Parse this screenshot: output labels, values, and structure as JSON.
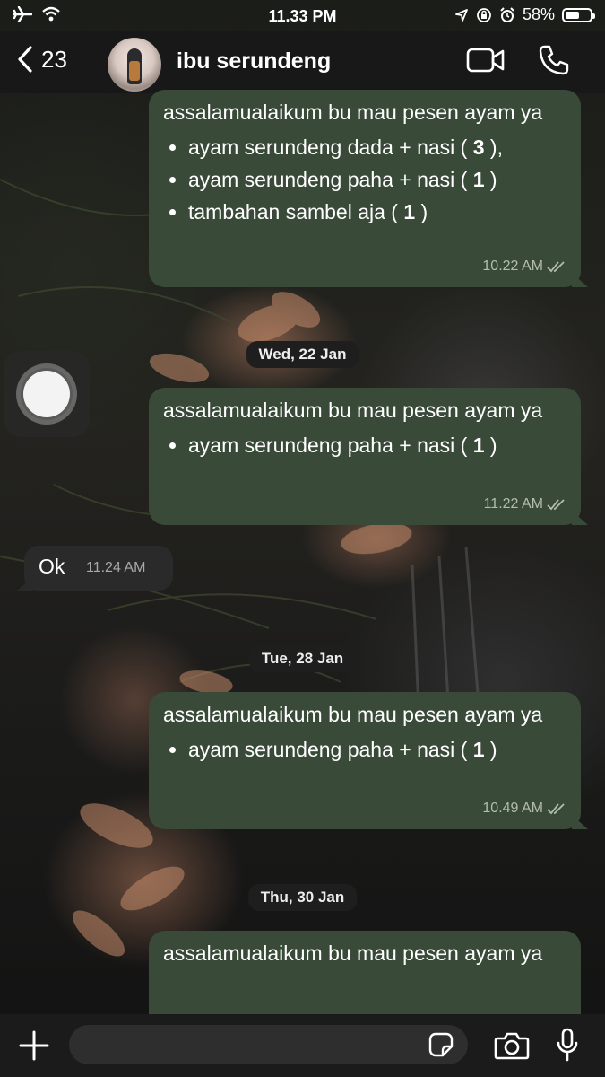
{
  "status_bar": {
    "time": "11.33 PM",
    "battery_percent": "58%",
    "battery_level": 0.58,
    "icons": [
      "airplane-icon",
      "wifi-icon",
      "location-icon",
      "orientation-lock-icon",
      "alarm-icon",
      "battery-icon"
    ]
  },
  "header": {
    "back_count": "23",
    "contact_name": "ibu serundeng",
    "icons": [
      "back-chevron-icon",
      "video-call-icon",
      "phone-call-icon"
    ]
  },
  "messages": [
    {
      "text": "assalamualaikum bu mau pesen ayam ya",
      "items": [
        {
          "text": "ayam serundeng dada + nasi ( ",
          "qty": "3",
          "suffix": " ),"
        },
        {
          "text": "ayam serundeng paha + nasi ( ",
          "qty": "1",
          "suffix": " )"
        },
        {
          "text": "tambahan sambel aja ( ",
          "qty": "1",
          "suffix": " )"
        }
      ],
      "time": "10.22 AM"
    },
    {
      "date": "Wed, 22 Jan",
      "text": "assalamualaikum bu mau pesen ayam ya",
      "items": [
        {
          "text": "ayam serundeng paha + nasi ( ",
          "qty": "1",
          "suffix": " )"
        }
      ],
      "time": "11.22 AM"
    },
    {
      "incoming_text": "Ok",
      "time": "11.24 AM"
    },
    {
      "date": "Tue, 28 Jan",
      "text": "assalamualaikum bu mau pesen ayam ya",
      "items": [
        {
          "text": "ayam serundeng paha + nasi ( ",
          "qty": "1",
          "suffix": " )"
        }
      ],
      "time": "10.49 AM"
    },
    {
      "date": "Thu, 30 Jan",
      "text": "assalamualaikum bu mau pesen ayam ya"
    }
  ],
  "input_bar": {
    "icons": [
      "plus-icon",
      "sticker-icon",
      "camera-icon",
      "microphone-icon"
    ]
  },
  "colors": {
    "outgoing_bubble": "#3a4a39",
    "incoming_bubble": "#2a2a2a",
    "header_bg": "#181818"
  }
}
